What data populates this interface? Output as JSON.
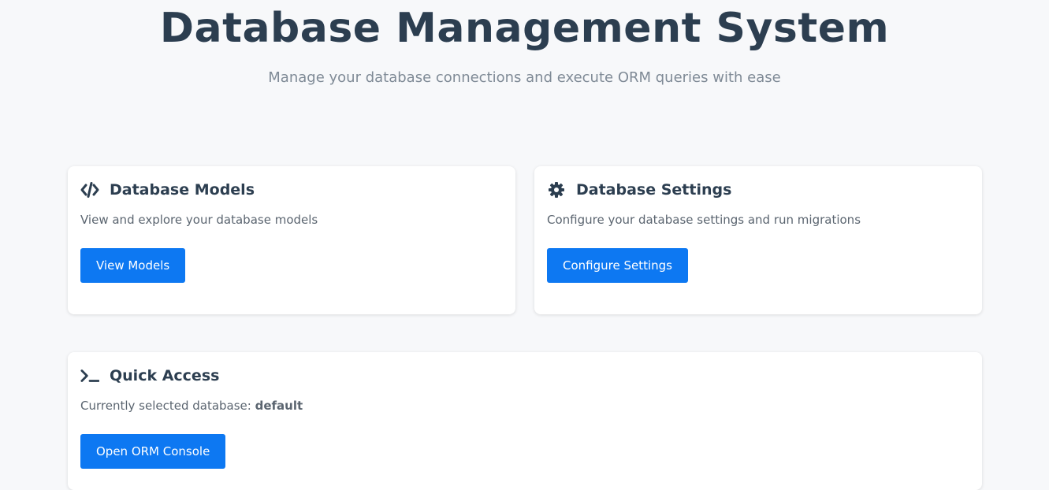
{
  "header": {
    "title": "Database Management System",
    "subtitle": "Manage your database connections and execute ORM queries with ease"
  },
  "cards": {
    "models": {
      "icon": "code-icon",
      "title": "Database Models",
      "description": "View and explore your database models",
      "button_label": "View Models"
    },
    "settings": {
      "icon": "gear-icon",
      "title": "Database Settings",
      "description": "Configure your database settings and run migrations",
      "button_label": "Configure Settings"
    },
    "quick_access": {
      "icon": "terminal-icon",
      "title": "Quick Access",
      "description_prefix": "Currently selected database: ",
      "selected_database": "default",
      "button_label": "Open ORM Console"
    }
  },
  "colors": {
    "accent": "#0d78f2",
    "title": "#2c3e50",
    "background": "#f7f8fa"
  }
}
